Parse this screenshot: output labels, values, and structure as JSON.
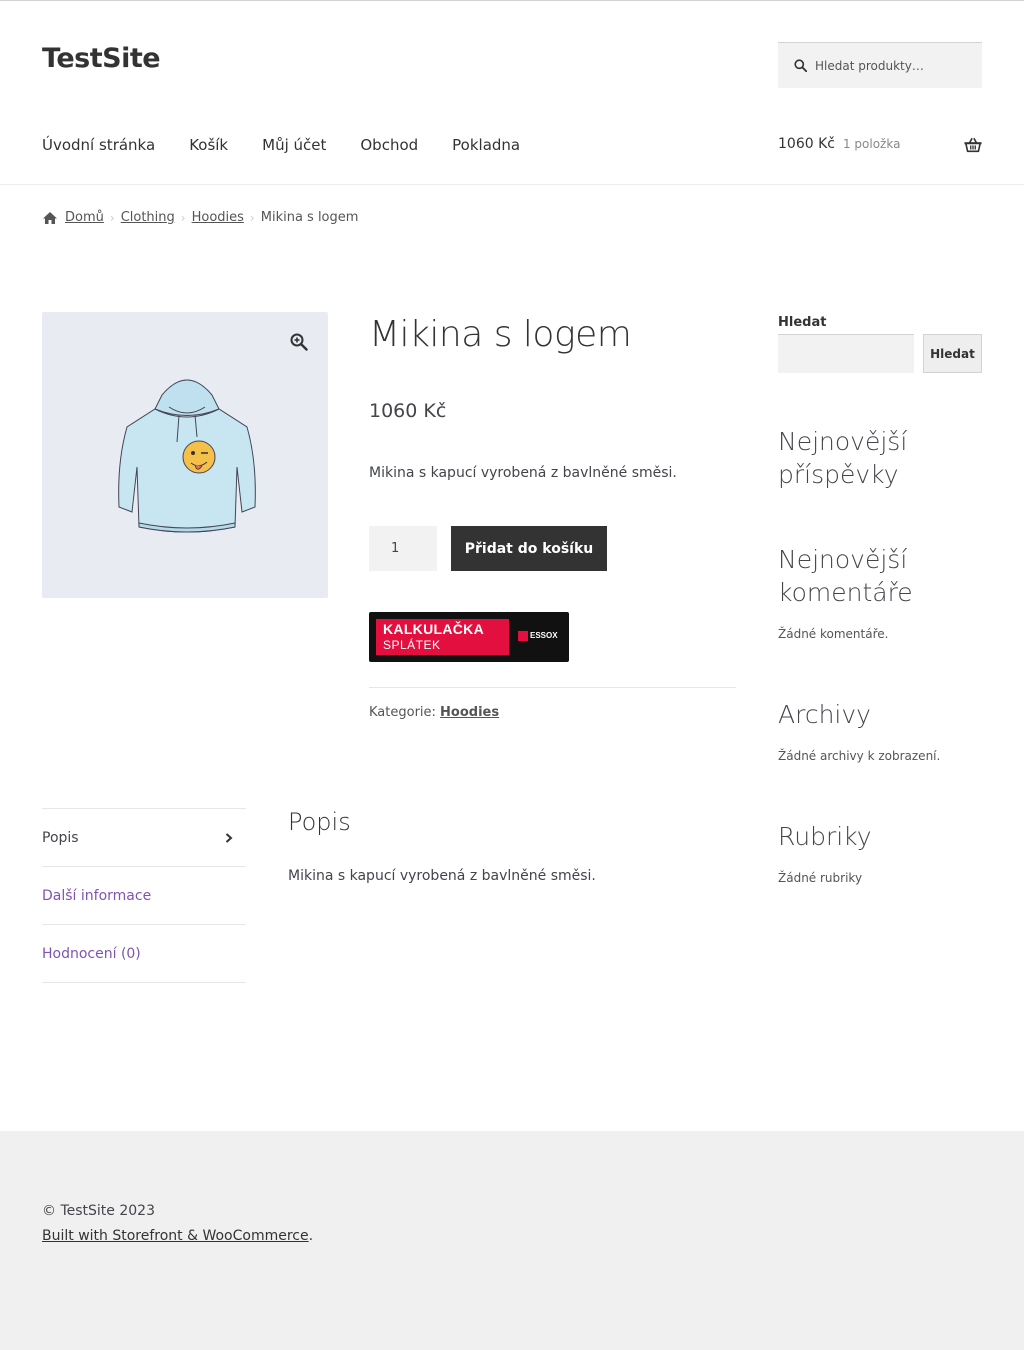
{
  "site": {
    "title": "TestSite"
  },
  "search": {
    "placeholder": "Hledat produkty…"
  },
  "nav": {
    "items": [
      "Úvodní stránka",
      "Košík",
      "Můj účet",
      "Obchod",
      "Pokladna"
    ]
  },
  "cart": {
    "amount": "1060 Kč",
    "count": "1 položka"
  },
  "breadcrumb": {
    "home": "Domů",
    "category": "Clothing",
    "subcategory": "Hoodies",
    "current": "Mikina s logem"
  },
  "product": {
    "title": "Mikina s logem",
    "price": "1060 Kč",
    "short_description": "Mikina s kapucí vyrobená z bavlněné směsi.",
    "quantity": "1",
    "add_to_cart_label": "Přidat do košíku",
    "calc_line1": "KALKULAČKA",
    "calc_line2": "SPLÁTEK",
    "calc_brand": "ESSOX",
    "categories_label": "Kategorie:",
    "category_link": "Hoodies"
  },
  "tabs": {
    "items": [
      "Popis",
      "Další informace",
      "Hodnocení (0)"
    ]
  },
  "panel": {
    "title": "Popis",
    "text": "Mikina s kapucí vyrobená z bavlněné směsi."
  },
  "sidebar": {
    "search_label": "Hledat",
    "search_button": "Hledat",
    "recent_posts_title": "Nejnovější příspěvky",
    "recent_comments_title": "Nejnovější komentáře",
    "recent_comments_text": "Žádné komentáře.",
    "archives_title": "Archivy",
    "archives_text": "Žádné archivy k zobrazení.",
    "categories_title": "Rubriky",
    "categories_text": "Žádné rubriky"
  },
  "footer": {
    "copyright": "© TestSite 2023",
    "built_with": "Built with Storefront & WooCommerce",
    "built_with_suffix": "."
  },
  "colors": {
    "accent": "#7f54b3",
    "button": "#333333",
    "calc_red": "#e30f3f"
  }
}
